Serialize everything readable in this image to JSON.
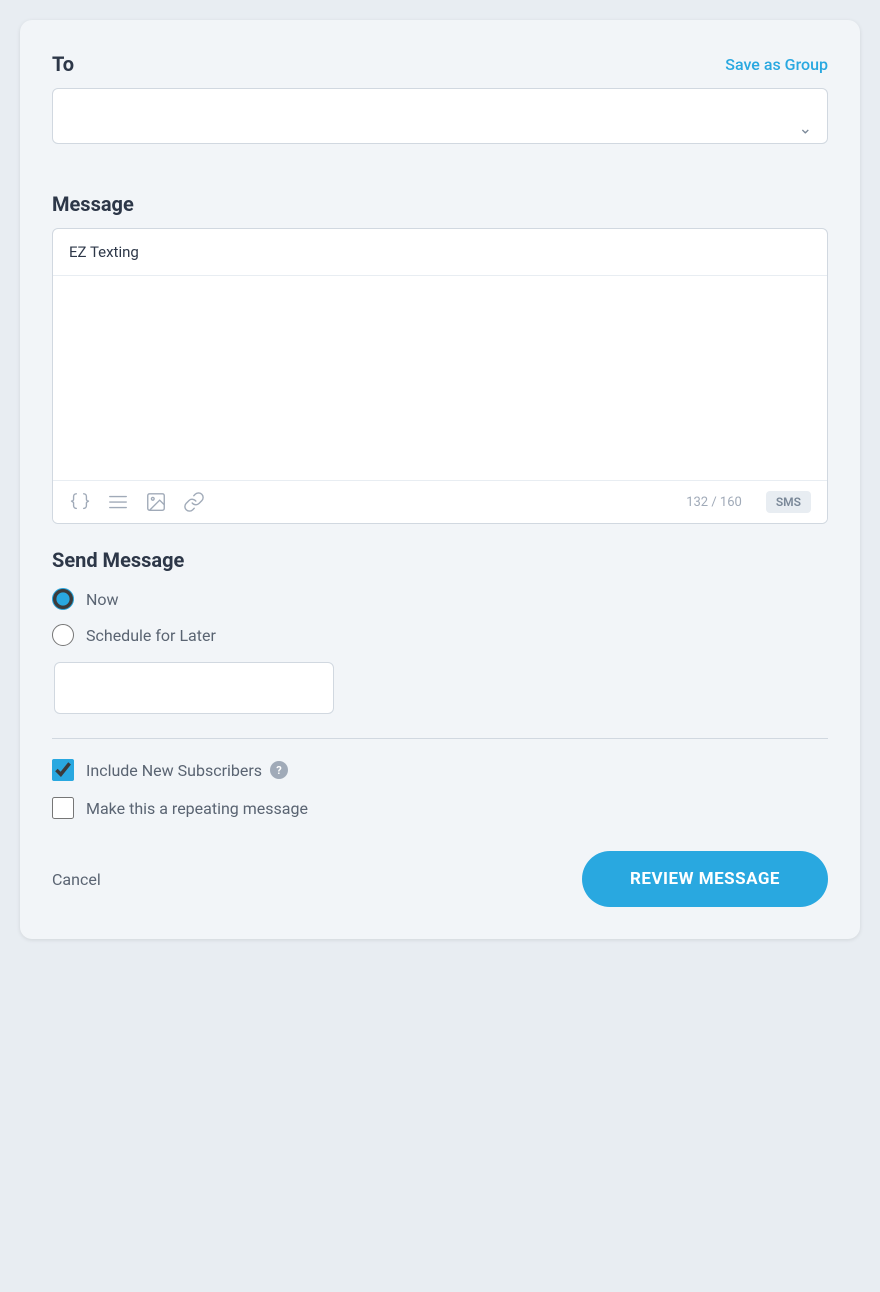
{
  "header": {
    "to_label": "To",
    "save_as_group_label": "Save as Group"
  },
  "to_dropdown": {
    "placeholder": "",
    "options": []
  },
  "message": {
    "section_title": "Message",
    "from_value": "EZ Texting",
    "body_placeholder": "",
    "char_count": "132 / 160",
    "sms_badge": "SMS"
  },
  "send_message": {
    "section_title": "Send Message",
    "now_label": "Now",
    "schedule_label": "Schedule for Later",
    "now_selected": true
  },
  "schedule_input": {
    "placeholder": "",
    "value": ""
  },
  "checkboxes": {
    "include_new_subscribers_label": "Include New Subscribers",
    "include_new_subscribers_checked": true,
    "repeating_message_label": "Make this a repeating message",
    "repeating_message_checked": false
  },
  "footer": {
    "cancel_label": "Cancel",
    "review_label": "REVIEW MESSAGE"
  },
  "icons": {
    "curly_braces": "{}",
    "list": "≡",
    "image": "🖼",
    "link": "🔗",
    "chevron_down": "⌄",
    "help": "?"
  }
}
